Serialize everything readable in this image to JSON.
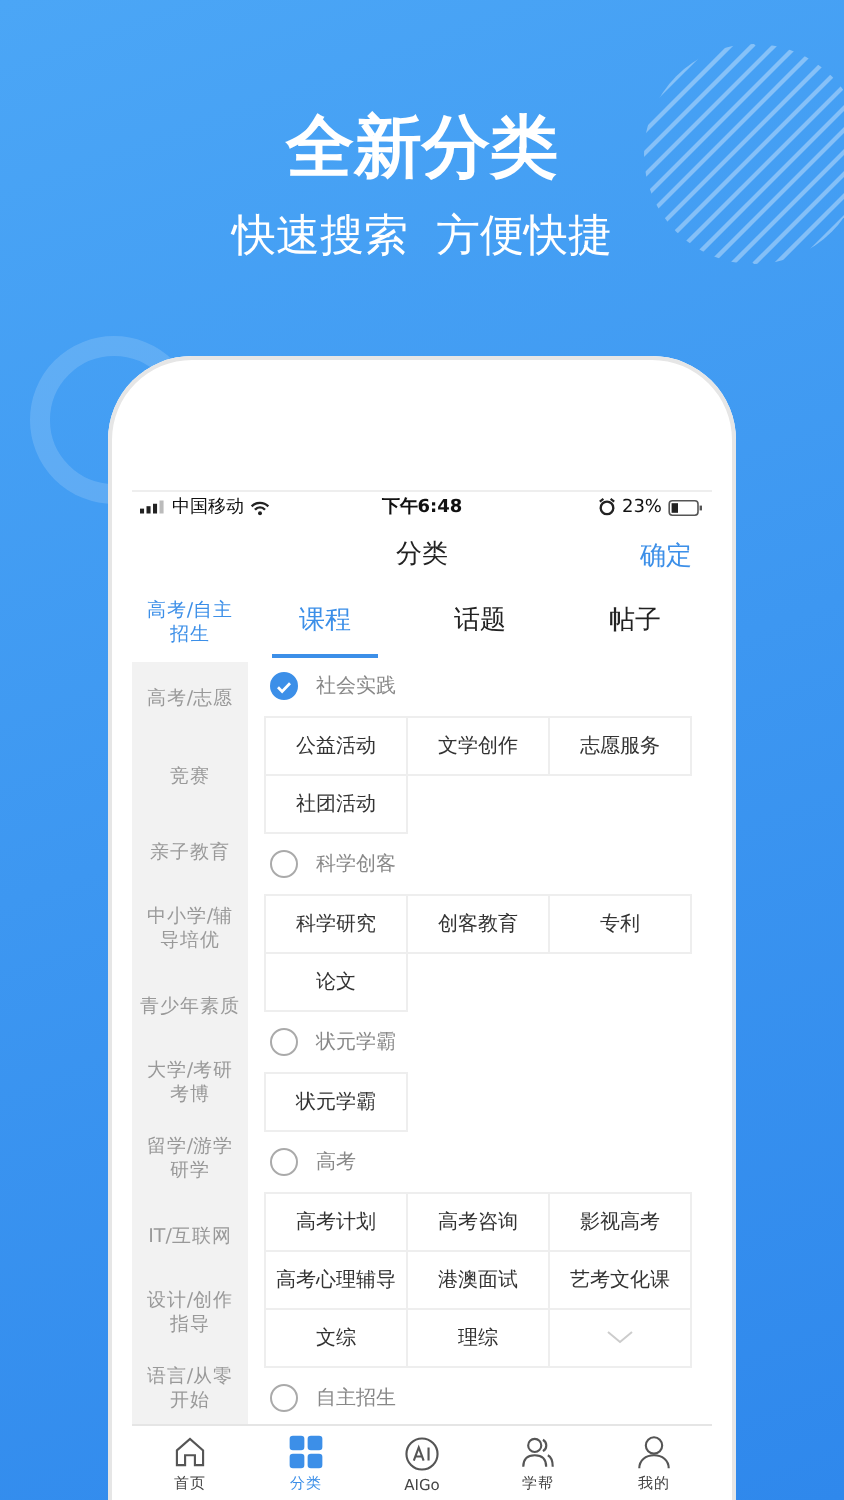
{
  "hero": {
    "title": "全新分类",
    "subtitle": "快速搜索  方便快捷"
  },
  "status_bar": {
    "carrier": "中国移动",
    "time": "下午6:48",
    "battery": "23%"
  },
  "nav": {
    "title": "分类",
    "action": "确定"
  },
  "sidebar": {
    "items": [
      {
        "label": "高考/自主招生",
        "selected": true
      },
      {
        "label": "高考/志愿",
        "selected": false
      },
      {
        "label": "竞赛",
        "selected": false
      },
      {
        "label": "亲子教育",
        "selected": false
      },
      {
        "label": "中小学/辅导培优",
        "selected": false
      },
      {
        "label": "青少年素质",
        "selected": false
      },
      {
        "label": "大学/考研考博",
        "selected": false
      },
      {
        "label": "留学/游学研学",
        "selected": false
      },
      {
        "label": "IT/互联网",
        "selected": false
      },
      {
        "label": "设计/创作指导",
        "selected": false
      },
      {
        "label": "语言/从零开始",
        "selected": false
      }
    ]
  },
  "tabs": [
    {
      "label": "课程",
      "selected": true
    },
    {
      "label": "话题",
      "selected": false
    },
    {
      "label": "帖子",
      "selected": false
    }
  ],
  "groups": [
    {
      "title": "社会实践",
      "checked": true,
      "tags": [
        "公益活动",
        "文学创作",
        "志愿服务",
        "社团活动"
      ]
    },
    {
      "title": "科学创客",
      "checked": false,
      "tags": [
        "科学研究",
        "创客教育",
        "专利",
        "论文"
      ]
    },
    {
      "title": "状元学霸",
      "checked": false,
      "tags": [
        "状元学霸"
      ]
    },
    {
      "title": "高考",
      "checked": false,
      "more": true,
      "tags": [
        "高考计划",
        "高考咨询",
        "影视高考",
        "高考心理辅导",
        "港澳面试",
        "艺考文化课",
        "文综",
        "理综"
      ]
    },
    {
      "title": "自主招生",
      "checked": false
    }
  ],
  "tab_bar": [
    {
      "kind": "home",
      "label": "首页",
      "selected": false
    },
    {
      "kind": "grid",
      "label": "分类",
      "selected": true
    },
    {
      "kind": "ai",
      "label": "AIGo",
      "selected": false
    },
    {
      "kind": "people",
      "label": "学帮",
      "selected": false
    },
    {
      "kind": "person",
      "label": "我的",
      "selected": false
    }
  ]
}
